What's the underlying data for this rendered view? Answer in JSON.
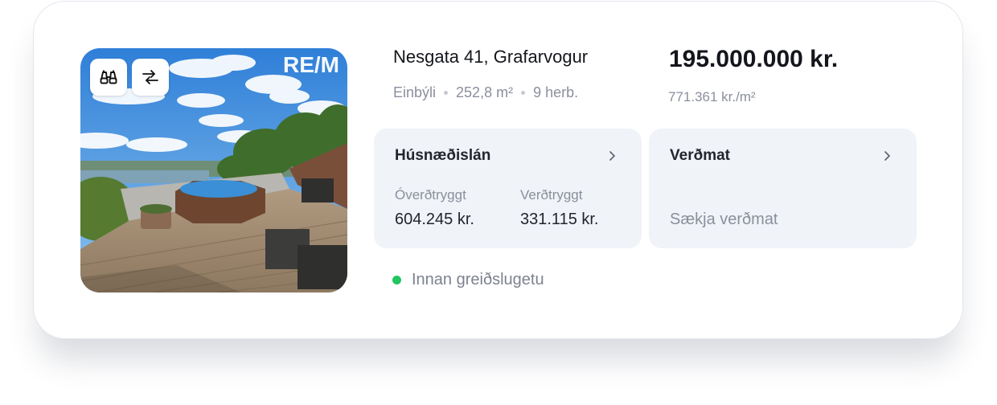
{
  "listing": {
    "address": "Nesgata 41, Grafarvogur",
    "type": "Einbýli",
    "size": "252,8 m²",
    "rooms": "9 herb.",
    "price": "195.000.000 kr.",
    "price_per_sqm": "771.361 kr./m²",
    "photo_watermark": "RE/M"
  },
  "photo_actions": [
    {
      "icon": "binoculars-icon"
    },
    {
      "icon": "compare-arrows-icon"
    }
  ],
  "mortgage_panel": {
    "title": "Húsnæðislán",
    "options": [
      {
        "label": "Óverðtryggt",
        "value": "604.245 kr."
      },
      {
        "label": "Verðtryggt",
        "value": "331.115 kr."
      }
    ]
  },
  "valuation_panel": {
    "title": "Verðmat",
    "action_text": "Sækja verðmat"
  },
  "affordability": {
    "text": "Innan greiðslugetu",
    "color": "#22c55e"
  },
  "colors": {
    "panel_bg": "#f0f3f8",
    "text_primary": "#14161c",
    "text_muted": "#8a8f9c"
  }
}
